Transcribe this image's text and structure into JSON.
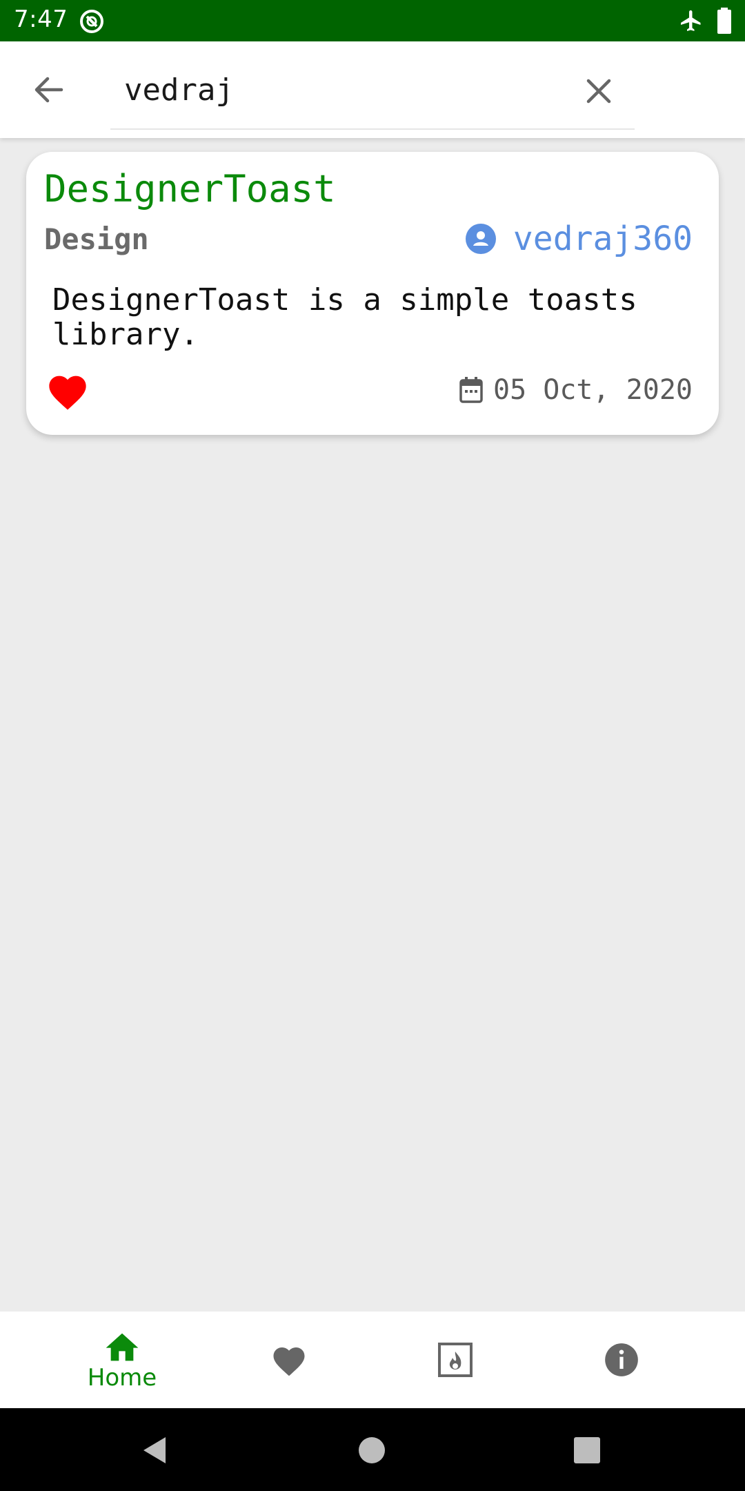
{
  "status_bar": {
    "time": "7:47",
    "background": "#006400"
  },
  "search": {
    "query": "vedraj",
    "back_icon": "arrow-left-icon",
    "clear_icon": "close-icon"
  },
  "results": [
    {
      "title": "DesignerToast",
      "category": "Design",
      "author": "vedraj360",
      "description": "DesignerToast is a simple toasts library.",
      "date": "05 Oct, 2020",
      "favorited": true
    }
  ],
  "colors": {
    "title": "#0b8a0b",
    "author": "#5b8fe0",
    "heart": "#ff0000",
    "nav_active": "#0b8a0b",
    "nav_inactive": "#666666"
  },
  "bottom_nav": {
    "items": [
      {
        "label": "Home",
        "icon": "home-icon",
        "active": true
      },
      {
        "label": "",
        "icon": "heart-icon",
        "active": false
      },
      {
        "label": "",
        "icon": "trending-icon",
        "active": false
      },
      {
        "label": "",
        "icon": "info-icon",
        "active": false
      }
    ]
  }
}
